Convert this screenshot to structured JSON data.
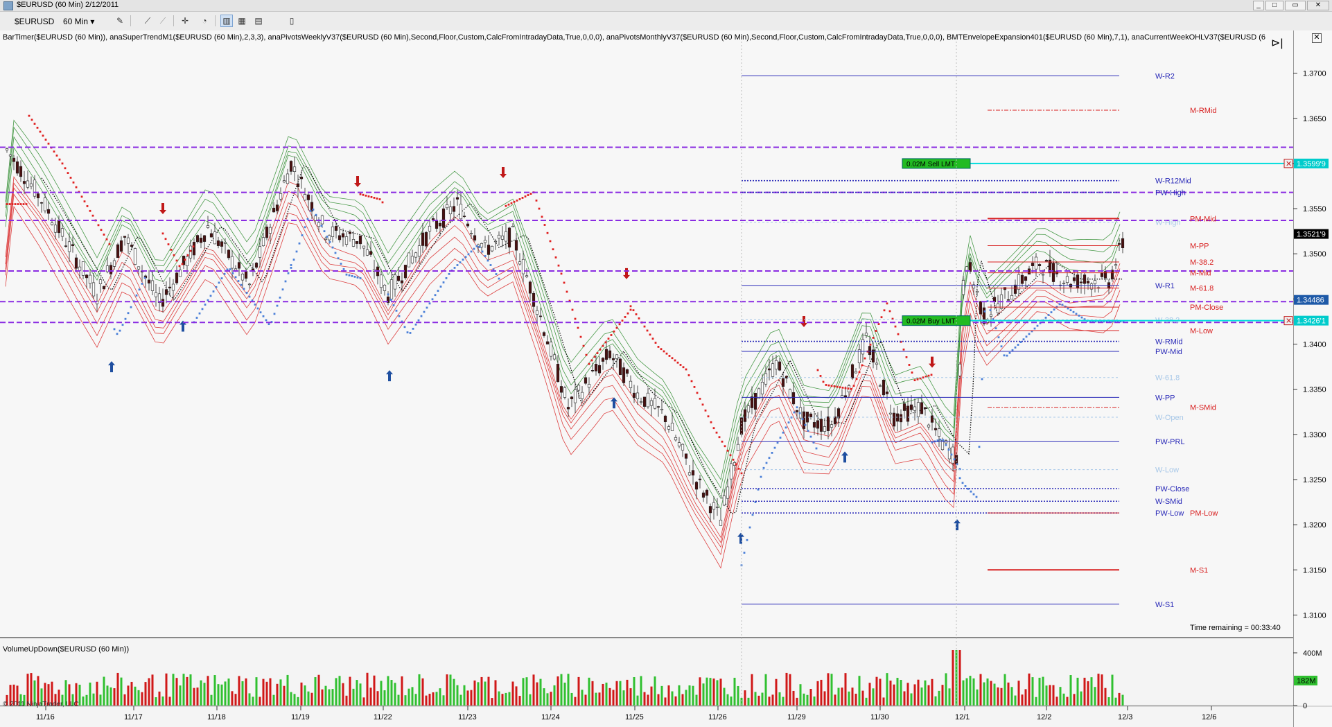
{
  "window": {
    "title": "$EURUSD (60 Min)  2/12/2011",
    "buttons": [
      "_",
      "□",
      "▭",
      "✕"
    ]
  },
  "toolbar": {
    "instrument": "$EURUSD",
    "interval": "60 Min",
    "icons": [
      "dropdown-icon",
      "pencil-icon",
      "line-tool-icon",
      "crosshair-icon",
      "zoom-icon",
      "bar-chart-icon",
      "candle-chart-icon",
      "properties-icon"
    ]
  },
  "indicators_text": "BarTimer($EURUSD (60 Min)), anaSuperTrendM1($EURUSD (60 Min),2,3,3), anaPivotsWeeklyV37($EURUSD (60 Min),Second,Floor,Custom,CalcFromIntradayData,True,0,0,0), anaPivotsMonthlyV37($EURUSD (60 Min),Second,Floor,Custom,CalcFromIntradayData,True,0,0,0), BMTEnvelopeExpansion401($EURUSD (60 Min),7,1), anaCurrentWeekOHLV37($EURUSD (6",
  "volume_label": "VolumeUpDown($EURUSD (60 Min))",
  "copyright": "© 2011 NinjaTrader, LLC",
  "time_remaining": "Time remaining = 00:33:40",
  "chart_data": {
    "type": "candlestick",
    "title": "$EURUSD (60 Min)",
    "ylim": [
      1.3075,
      1.3735
    ],
    "y_ticks": [
      "1.3700",
      "1.3650",
      "1.3600",
      "1.3550",
      "1.3500",
      "1.3450",
      "1.3400",
      "1.3350",
      "1.3300",
      "1.3250",
      "1.3200",
      "1.3150",
      "1.3100"
    ],
    "x_ticks": [
      "11/16",
      "11/17",
      "11/18",
      "11/19",
      "11/22",
      "11/23",
      "11/24",
      "11/25",
      "11/26",
      "11/29",
      "11/30",
      "12/1",
      "12/2",
      "12/3",
      "12/6"
    ],
    "price_labels": [
      {
        "text": "1.3599'9",
        "value": 1.36,
        "color": "#00cccc"
      },
      {
        "text": "1.3521'9",
        "value": 1.3522,
        "color": "#000000"
      },
      {
        "text": "1.34486",
        "value": 1.3449,
        "color": "#1e5aa8"
      },
      {
        "text": "1.3426'1",
        "value": 1.3426,
        "color": "#00cccc"
      }
    ],
    "orders": [
      {
        "qty": "0.02M",
        "type": "Sell LMT",
        "value": 1.36
      },
      {
        "qty": "0.02M",
        "type": "Buy LMT",
        "value": 1.3426
      }
    ],
    "weekly_pivots": [
      {
        "label": "W-R2",
        "value": 1.3697
      },
      {
        "label": "W-R12Mid",
        "value": 1.3581
      },
      {
        "label": "PW-High",
        "value": 1.3568
      },
      {
        "label": "W-High",
        "value": 1.3535
      },
      {
        "label": "W-R1",
        "value": 1.3465
      },
      {
        "label": "W-38.2",
        "value": 1.3427
      },
      {
        "label": "W-RMid",
        "value": 1.3403
      },
      {
        "label": "PW-Mid",
        "value": 1.3392
      },
      {
        "label": "W-61.8",
        "value": 1.3363
      },
      {
        "label": "W-PP",
        "value": 1.3341
      },
      {
        "label": "W-Open",
        "value": 1.3319
      },
      {
        "label": "PW-PRL",
        "value": 1.3292
      },
      {
        "label": "W-Low",
        "value": 1.3261
      },
      {
        "label": "PW-Close",
        "value": 1.324
      },
      {
        "label": "W-SMid",
        "value": 1.3226
      },
      {
        "label": "PW-Low",
        "value": 1.3213
      },
      {
        "label": "W-S1",
        "value": 1.3112
      }
    ],
    "monthly_pivots": [
      {
        "label": "M-RMid",
        "value": 1.3659
      },
      {
        "label": "PM-Mid",
        "value": 1.3539
      },
      {
        "label": "M-PP",
        "value": 1.3509
      },
      {
        "label": "M-38.2",
        "value": 1.3491
      },
      {
        "label": "M-Mid",
        "value": 1.3479
      },
      {
        "label": "M-61.8",
        "value": 1.3462
      },
      {
        "label": "PM-Close",
        "value": 1.3441
      },
      {
        "label": "M-Low",
        "value": 1.3415
      },
      {
        "label": "M-SMid",
        "value": 1.333
      },
      {
        "label": "PM-Low",
        "value": 1.3213
      },
      {
        "label": "M-S1",
        "value": 1.315
      }
    ],
    "horizontal_levels": [
      1.3618,
      1.3568,
      1.3537,
      1.3481,
      1.3447,
      1.3424
    ],
    "volume": {
      "ticks": [
        "400M",
        "182M",
        "0"
      ],
      "last": "182M"
    }
  },
  "colors": {
    "up": "#ffffff",
    "down": "#4a1010",
    "supertrend_up": "#4a7fd8",
    "supertrend_down": "#e02020",
    "level": "#8a2be2",
    "pivot_w": "#2a2ab8",
    "pivot_m": "#d82020",
    "band_green": "#2a8a2a",
    "band_red": "#d82020"
  }
}
